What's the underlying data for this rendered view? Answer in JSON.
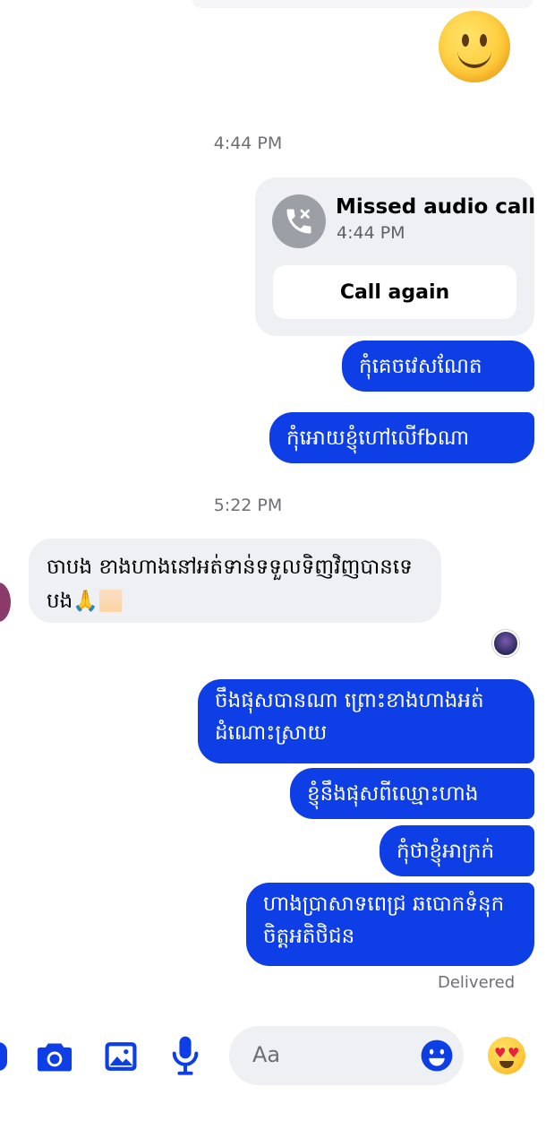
{
  "thread": {
    "timestamp_1": "4:44 PM",
    "missed_call": {
      "title": "Missed audio call",
      "time": "4:44 PM",
      "action_label": "Call again"
    },
    "sent_1": "កុំគេចវេសណែត",
    "sent_2": "កុំអោយខ្ញុំហៅលើfbណា",
    "timestamp_2": "5:22 PM",
    "received_1": "ចាបង ខាងហាងនៅអត់ទាន់ទទួលទិញវិញបានទេ បង🙏🏻",
    "sent_3": "ចឹងផុសបានណា ព្រោះខាងហាងអត់ដំណោះស្រាយ",
    "sent_4": "ខ្ញុំនឹងផុសពីឈ្មោះហាង",
    "sent_5": "កុំថាខ្ញុំអាក្រក់",
    "sent_6": "ហាងប្រាសាទពេជ្រ ឆបោកទំនុកចិត្តអតិថិជន",
    "status": "Delivered"
  },
  "composer": {
    "placeholder": "Aa"
  },
  "colors": {
    "accent": "#0d3ee6",
    "bubble_incoming": "#eef0f4",
    "timestamp": "#6e6e73"
  },
  "icons": [
    "smiley-emoji-icon",
    "missed-call-icon",
    "camera-icon",
    "image-icon",
    "microphone-icon",
    "emoji-picker-icon",
    "heart-eyes-emoji-icon"
  ]
}
